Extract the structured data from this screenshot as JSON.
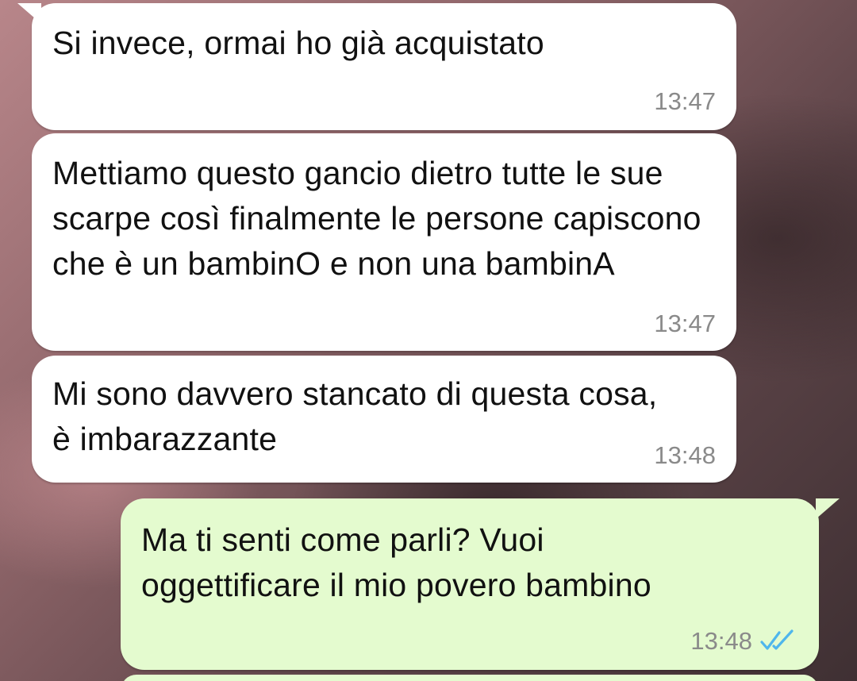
{
  "messages": [
    {
      "direction": "incoming",
      "text": "Si invece, ormai ho già acquistato",
      "time": "13:47"
    },
    {
      "direction": "incoming",
      "text": "Mettiamo questo gancio dietro tutte le sue scarpe così finalmente le persone capiscono che è un bambinO e non una bambinA",
      "time": "13:47"
    },
    {
      "direction": "incoming",
      "text": "Mi sono davvero stancato di questa cosa, è imbarazzante",
      "time": "13:48"
    },
    {
      "direction": "outgoing",
      "text": "Ma ti senti come parli? Vuoi oggettificare il mio povero bambino",
      "time": "13:48",
      "status": "read",
      "status_icon": "double-check-icon"
    }
  ],
  "colors": {
    "incoming_bubble": "#ffffff",
    "outgoing_bubble": "#e4fbcf",
    "read_ticks": "#4fb6ec",
    "timestamp": "#8a8a8a"
  }
}
